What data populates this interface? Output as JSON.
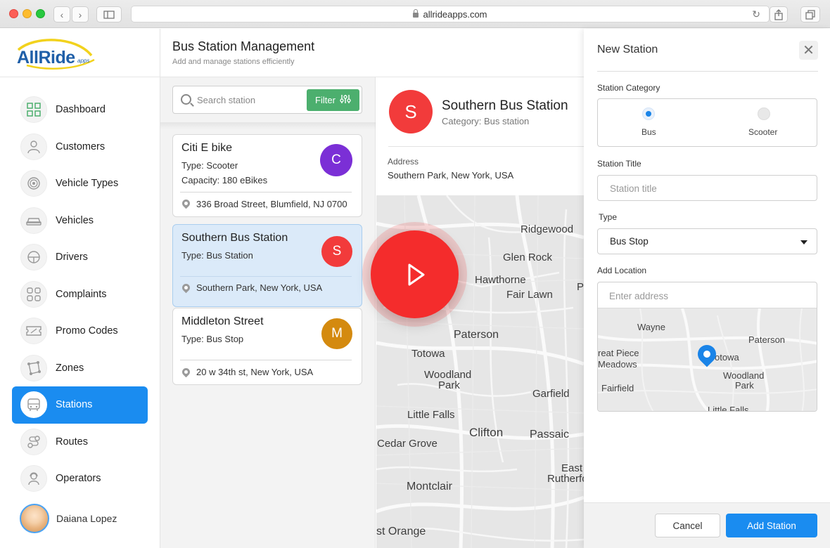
{
  "browser": {
    "url": "allrideapps.com"
  },
  "brand": {
    "logo_text": "AllRide",
    "logo_sub": "apps",
    "accent": "#1a8cf0"
  },
  "sidebar": {
    "items": [
      {
        "label": "Dashboard",
        "icon": "dashboard-icon"
      },
      {
        "label": "Customers",
        "icon": "user-icon"
      },
      {
        "label": "Vehicle Types",
        "icon": "wheel-icon"
      },
      {
        "label": "Vehicles",
        "icon": "car-icon"
      },
      {
        "label": "Drivers",
        "icon": "steering-wheel-icon"
      },
      {
        "label": "Complaints",
        "icon": "complaints-icon"
      },
      {
        "label": "Promo Codes",
        "icon": "ticket-icon"
      },
      {
        "label": "Zones",
        "icon": "zones-icon"
      },
      {
        "label": "Stations",
        "icon": "bus-icon",
        "active": true
      },
      {
        "label": "Routes",
        "icon": "route-icon"
      },
      {
        "label": "Operators",
        "icon": "operator-icon"
      }
    ],
    "user": {
      "name": "Daiana Lopez"
    }
  },
  "header": {
    "title": "Bus Station Management",
    "subtitle": "Add and manage stations efficiently"
  },
  "search": {
    "placeholder": "Search station",
    "filter_label": "Filter"
  },
  "stations": [
    {
      "title": "Citi E bike",
      "type": "Type: Scooter",
      "capacity": "Capacity: 180 eBikes",
      "address": "336 Broad Street, Blumfield, NJ 0700",
      "badge": "C",
      "color": "#7b2fd6"
    },
    {
      "title": "Southern Bus Station",
      "type": "Type: Bus Station",
      "address": "Southern Park, New York, USA",
      "badge": "S",
      "color": "#f23b3b",
      "selected": true
    },
    {
      "title": "Middleton Street",
      "type": "Type: Bus Stop",
      "address": "20 w 34th st, New York, USA",
      "badge": "M",
      "color": "#d48a0f"
    }
  ],
  "detail": {
    "badge": "S",
    "title": "Southern Bus Station",
    "category": "Category: Bus station",
    "address_label": "Address",
    "address": "Southern Park, New York, USA"
  },
  "map_labels": [
    "Ridgewood",
    "Glen Rock",
    "Hawthorne",
    "Fair Lawn",
    "P",
    "Paterson",
    "Totowa",
    "Woodland",
    "Park",
    "Garfield",
    "Little Falls",
    "Clifton",
    "Passaic",
    "Cedar Grove",
    "East",
    "Rutherfo",
    "Montclair",
    "st Orange"
  ],
  "new_station": {
    "title": "New Station",
    "category_label": "Station Category",
    "categories": [
      {
        "label": "Bus",
        "selected": true
      },
      {
        "label": "Scooter",
        "selected": false
      }
    ],
    "title_label": "Station Title",
    "title_placeholder": "Station title",
    "type_label": "Type",
    "type_value": "Bus Stop",
    "location_label": "Add Location",
    "location_placeholder": "Enter address",
    "minimap_labels": [
      "Wayne",
      "Paterson",
      "reat Piece",
      "Meadows",
      "otowa",
      "Woodland",
      "Park",
      "Fairfield",
      "Little Falls"
    ],
    "cancel_label": "Cancel",
    "add_label": "Add Station"
  }
}
